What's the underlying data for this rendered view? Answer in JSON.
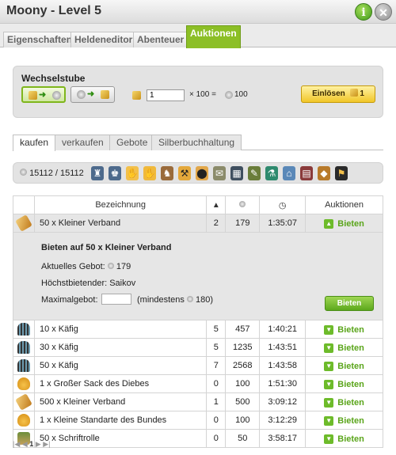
{
  "window": {
    "title": "Moony - Level 5"
  },
  "main_tabs": [
    "Eigenschaften",
    "Heldeneditor",
    "Abenteuer",
    "Auktionen"
  ],
  "exchange": {
    "title": "Wechselstube",
    "amount_value": "1",
    "multiplier": "× 100 =",
    "result": "100",
    "redeem_label": "Einlösen",
    "redeem_count": "1"
  },
  "sub_tabs": [
    "kaufen",
    "verkaufen",
    "Gebote",
    "Silberbuchhaltung"
  ],
  "filter": {
    "silver": "15112 / 15112"
  },
  "table": {
    "headers": [
      "Bezeichnung",
      "Auktionen"
    ],
    "selected": {
      "name": "50 x Kleiner Verband",
      "qty": "2",
      "price": "179",
      "time": "1:35:07",
      "action": "Bieten"
    },
    "detail": {
      "title": "Bieten auf 50 x Kleiner Verband",
      "current_bid_label": "Aktuelles Gebot:",
      "current_bid": "179",
      "highest_bidder": "Höchstbietender: Saikov",
      "max_bid_label": "Maximalgebot:",
      "min_hint_prefix": "(mindestens",
      "min_hint_value": "180)",
      "button": "Bieten"
    },
    "rows": [
      {
        "icon": "cage-icon",
        "name": "10 x Käfig",
        "qty": "5",
        "price": "457",
        "time": "1:40:21",
        "action": "Bieten"
      },
      {
        "icon": "cage-icon",
        "name": "30 x Käfig",
        "qty": "5",
        "price": "1235",
        "time": "1:43:51",
        "action": "Bieten"
      },
      {
        "icon": "cage-icon",
        "name": "50 x Käfig",
        "qty": "7",
        "price": "2568",
        "time": "1:43:58",
        "action": "Bieten"
      },
      {
        "icon": "hand-icon",
        "name": "1 x Großer Sack des Diebes",
        "qty": "0",
        "price": "100",
        "time": "1:51:30",
        "action": "Bieten"
      },
      {
        "icon": "bandage-icon",
        "name": "500 x Kleiner Verband",
        "qty": "1",
        "price": "500",
        "time": "3:09:12",
        "action": "Bieten"
      },
      {
        "icon": "hand-icon",
        "name": "1 x Kleine Standarte des Bundes",
        "qty": "0",
        "price": "100",
        "time": "3:12:29",
        "action": "Bieten"
      },
      {
        "icon": "scroll-icon",
        "name": "50 x Schriftrolle",
        "qty": "0",
        "price": "50",
        "time": "3:58:17",
        "action": "Bieten"
      }
    ]
  },
  "pager": {
    "current": "1"
  }
}
